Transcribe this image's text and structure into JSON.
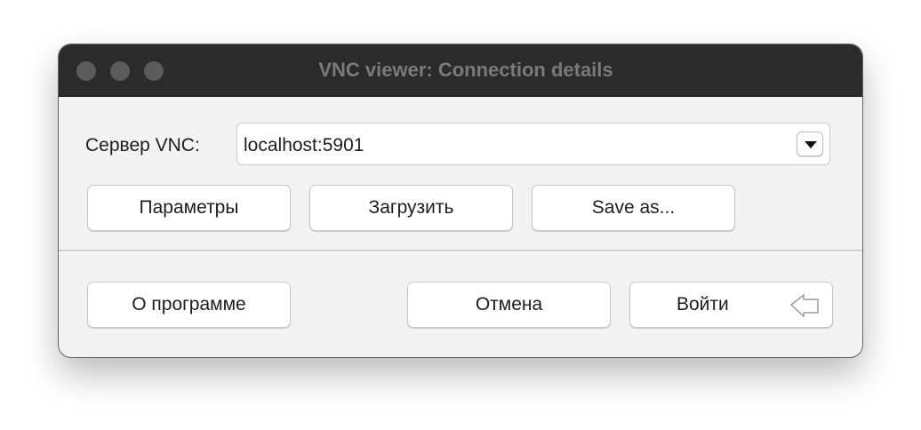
{
  "window": {
    "title": "VNC viewer: Connection details"
  },
  "server": {
    "label": "Сервер VNC:",
    "value": "localhost:5901"
  },
  "buttons": {
    "params": "Параметры",
    "load": "Загрузить",
    "save_as": "Save as...",
    "about": "О программе",
    "cancel": "Отмена",
    "connect": "Войти"
  },
  "icons": {
    "dropdown": "chevron-down-icon",
    "enter": "return-key-icon"
  }
}
